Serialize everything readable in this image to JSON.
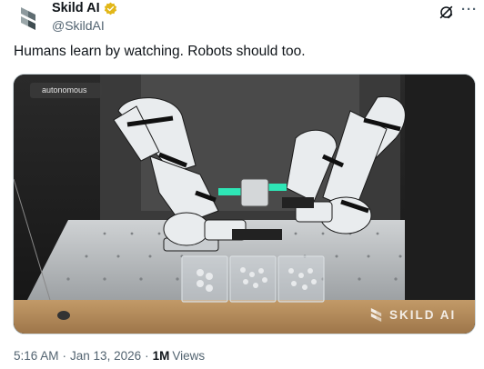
{
  "author": {
    "display_name": "Skild AI",
    "handle": "@SkildAI",
    "avatar_icon": "skild-logo-icon",
    "verified_icon": "verified-badge-icon",
    "verified_color": "#e2b719"
  },
  "actions": {
    "grok_icon": "grok-icon",
    "more_icon": "more-options-icon",
    "more_label": "···"
  },
  "tweet": {
    "text": "Humans learn by watching. Robots should too."
  },
  "media": {
    "badge_label": "autonomous",
    "watermark_text": "SKILD AI",
    "watermark_icon": "skild-logo-icon"
  },
  "meta": {
    "time": "5:16 AM",
    "separator": "·",
    "date": "Jan 13, 2026",
    "views_count": "1M",
    "views_label": "Views"
  }
}
